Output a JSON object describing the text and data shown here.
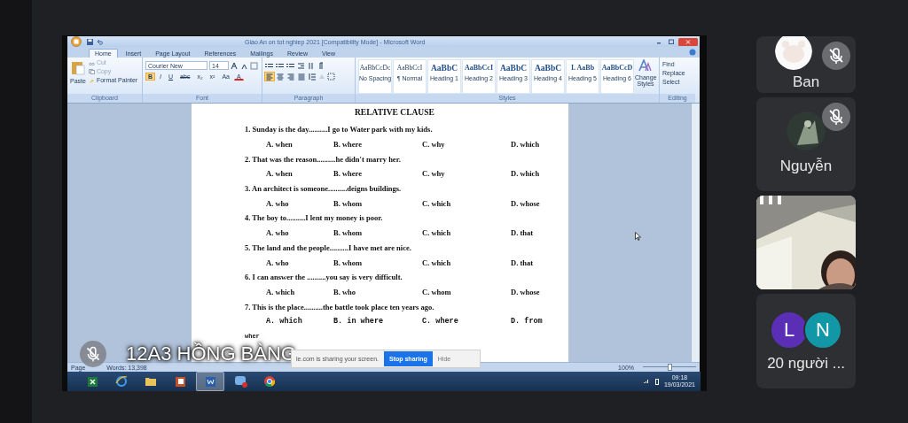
{
  "word": {
    "title": "Giao An on tot nghiep 2021 [Compatibility Mode] - Microsoft Word",
    "tabs": [
      {
        "label": "Home",
        "selected": true
      },
      {
        "label": "Insert",
        "selected": false
      },
      {
        "label": "Page Layout",
        "selected": false
      },
      {
        "label": "References",
        "selected": false
      },
      {
        "label": "Mailings",
        "selected": false
      },
      {
        "label": "Review",
        "selected": false
      },
      {
        "label": "View",
        "selected": false
      }
    ],
    "clipboard": {
      "paste": "Paste",
      "cut": "Cut",
      "copy": "Copy",
      "format_painter": "Format Painter",
      "group": "Clipboard"
    },
    "font": {
      "name": "Courier New",
      "size": "14",
      "buttons": [
        {
          "label": "B",
          "selected": true
        },
        {
          "label": "I",
          "selected": false
        },
        {
          "label": "U",
          "selected": false
        },
        {
          "label": "abc",
          "selected": false
        },
        {
          "label": "x₂",
          "selected": false
        },
        {
          "label": "x²",
          "selected": false
        },
        {
          "label": "Aa",
          "selected": false
        },
        {
          "label": "A",
          "selected": false
        }
      ],
      "group": "Font"
    },
    "paragraph": {
      "alignments": [
        {
          "kind": "left",
          "selected": true
        },
        {
          "kind": "center",
          "selected": false
        },
        {
          "kind": "right",
          "selected": false
        },
        {
          "kind": "justify",
          "selected": false
        }
      ],
      "group": "Paragraph"
    },
    "styles": {
      "items": [
        {
          "sample": "AaBbCcDc",
          "label": "No Spacing"
        },
        {
          "sample": "AaBbCcI",
          "label": "¶ Normal"
        },
        {
          "sample": "AaBbC",
          "label": "Heading 1"
        },
        {
          "sample": "AaBbCcI",
          "label": "Heading 2"
        },
        {
          "sample": "AaBbC",
          "label": "Heading 3"
        },
        {
          "sample": "AaBbC",
          "label": "Heading 4"
        },
        {
          "sample": "I. AaBb",
          "label": "Heading 5"
        },
        {
          "sample": "AaBbCcD",
          "label": "Heading 6"
        }
      ],
      "change": "Change Styles",
      "group": "Styles"
    },
    "editing": {
      "items": [
        "Find",
        "Replace",
        "Select"
      ],
      "group": "Editing"
    },
    "document": {
      "title": "RELATIVE CLAUSE",
      "questions": [
        {
          "kind": "serif",
          "text": "1. Sunday is the day..........I go to Water park with my kids.",
          "options": [
            "A. when",
            "B. where",
            "C. why",
            "D. which"
          ]
        },
        {
          "kind": "serif",
          "text": "2. That was the reason..........he didn't marry her.",
          "options": [
            "A. when",
            "B. where",
            "C. why",
            "D. which"
          ]
        },
        {
          "kind": "serif",
          "text": "3. An architect is someone..........deigns buildings.",
          "options": [
            "A. who",
            "B. whom",
            "C. which",
            "D. whose"
          ]
        },
        {
          "kind": "serif",
          "text": "4. The boy to..........I lent my money is poor.",
          "options": [
            "A. who",
            "B. whom",
            "C. which",
            "D. that"
          ]
        },
        {
          "kind": "serif",
          "text": "5. The land and the people..........I have met are nice.",
          "options": [
            "A. who",
            "B. whom",
            "C. which",
            "D. that"
          ]
        },
        {
          "kind": "serif",
          "text": "6. I can answer the ..........you say is very difficult.",
          "options": [
            "A. which",
            "B. who",
            "C. whom",
            "D. whose"
          ]
        },
        {
          "kind": "mono",
          "text": "7. This is the place..........the battle took place ten years ago.",
          "options": [
            "A. which",
            "B. in where",
            "C. where",
            "D. from"
          ]
        }
      ],
      "trailing": "wher"
    },
    "status_bar": {
      "page": "Page",
      "words": "Words: 13,398",
      "zoom": "100%",
      "zoom_slider": {
        "level": 0.5
      }
    }
  },
  "taskbar": {
    "apps": [
      {
        "kind": "spreadsheet",
        "selected": false
      },
      {
        "kind": "browser",
        "selected": false
      },
      {
        "kind": "folder",
        "selected": false
      },
      {
        "kind": "presentation",
        "selected": false
      },
      {
        "kind": "document",
        "selected": true
      },
      {
        "kind": "chat",
        "selected": false
      },
      {
        "kind": "chrome",
        "selected": false
      }
    ],
    "time": "09:18",
    "date": "19/03/2021"
  },
  "presenter": {
    "name": "12A3 HỒNG BÀNG",
    "muted": true
  },
  "share_bar": {
    "message": "le.com is sharing your screen.",
    "stop": "Stop sharing",
    "hide": "Hide"
  },
  "participants": [
    {
      "kind": "avatar",
      "name": "Ban",
      "muted": true
    },
    {
      "kind": "avatar",
      "name": "Nguyễn",
      "muted": true
    },
    {
      "kind": "video",
      "muted": false
    },
    {
      "kind": "group",
      "initials": [
        {
          "letter": "L",
          "color": "#5b2fb5"
        },
        {
          "letter": "N",
          "color": "#1297a6"
        }
      ],
      "name": "20 người ..."
    }
  ]
}
